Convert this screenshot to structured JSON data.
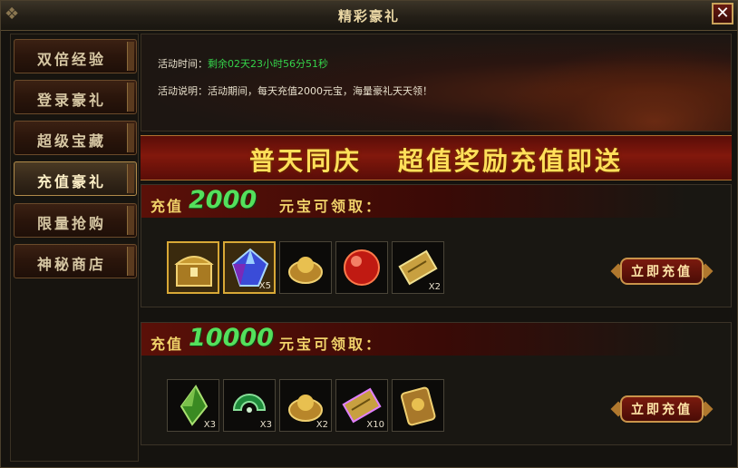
{
  "window": {
    "title": "精彩豪礼",
    "close_label": "✕"
  },
  "sidebar": {
    "items": [
      {
        "label": "双倍经验",
        "active": false
      },
      {
        "label": "登录豪礼",
        "active": false
      },
      {
        "label": "超级宝藏",
        "active": false
      },
      {
        "label": "充值豪礼",
        "active": true
      },
      {
        "label": "限量抢购",
        "active": false
      },
      {
        "label": "神秘商店",
        "active": false
      }
    ]
  },
  "banner": {
    "time_label": "活动时间：",
    "time_value": "剩余02天23小时56分51秒",
    "desc_label": "活动说明：",
    "desc_value": "活动期间，每天充值2000元宝，海量豪礼天天领！"
  },
  "slogan": {
    "left": "普天同庆",
    "right": "超值奖励充值即送"
  },
  "tiers": [
    {
      "prefix": "充值",
      "amount": "2000",
      "suffix": "元宝可领取：",
      "button": "立即充值",
      "items": [
        {
          "icon": "treasure-chest-icon",
          "count": "",
          "highlight": true
        },
        {
          "icon": "blue-gem-icon",
          "count": "X5",
          "highlight": true
        },
        {
          "icon": "gold-ingot-icon",
          "count": "",
          "highlight": false
        },
        {
          "icon": "red-orb-icon",
          "count": "",
          "highlight": false
        },
        {
          "icon": "scroll-icon",
          "count": "X2",
          "highlight": false
        }
      ]
    },
    {
      "prefix": "充值",
      "amount": "10000",
      "suffix": "元宝可领取：",
      "button": "立即充值",
      "items": [
        {
          "icon": "green-crystal-icon",
          "count": "X3",
          "highlight": false
        },
        {
          "icon": "green-jade-icon",
          "count": "X3",
          "highlight": false
        },
        {
          "icon": "gold-ingot-icon",
          "count": "X2",
          "highlight": false
        },
        {
          "icon": "scroll-icon",
          "count": "X10",
          "highlight": false
        },
        {
          "icon": "gold-plaque-icon",
          "count": "",
          "highlight": false
        }
      ]
    }
  ],
  "colors": {
    "accent_gold": "#f1d36a",
    "amount_green": "#54e05c",
    "timer_green": "#35d24a",
    "slogan_yellow": "#ffe05a"
  }
}
